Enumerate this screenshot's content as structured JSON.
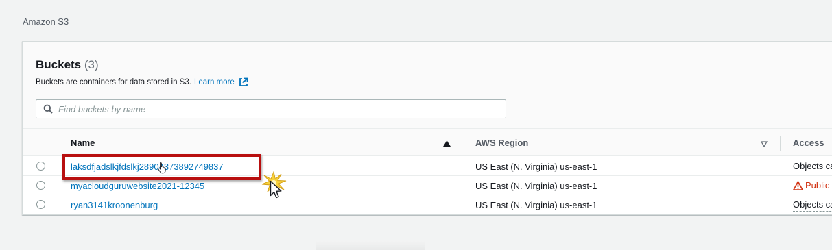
{
  "breadcrumb": "Amazon S3",
  "buckets_panel": {
    "title": "Buckets",
    "count": "(3)",
    "description": "Buckets are containers for data stored in S3.",
    "learn_more": "Learn more",
    "search_placeholder": "Find buckets by name",
    "columns": {
      "name": "Name",
      "region": "AWS Region",
      "access": "Access"
    },
    "rows": [
      {
        "name": "laksdfjadslkjfdslkj28904373892749837",
        "region": "US East (N. Virginia) us-east-1",
        "access": "Objects ca"
      },
      {
        "name": "myacloudguruwebsite2021-12345",
        "region": "US East (N. Virginia) us-east-1",
        "access": "Public"
      },
      {
        "name": "ryan3141kroonenburg",
        "region": "US East (N. Virginia) us-east-1",
        "access": "Objects ca"
      }
    ]
  },
  "colors": {
    "link": "#0073bb",
    "warning": "#d13212",
    "highlight": "#b80f0f"
  },
  "icons": [
    "external-link-icon",
    "search-icon",
    "sort-ascending-icon",
    "sort-descending-icon",
    "warning-icon",
    "hand-pointer-icon",
    "arrow-pointer-icon",
    "click-burst-icon"
  ]
}
